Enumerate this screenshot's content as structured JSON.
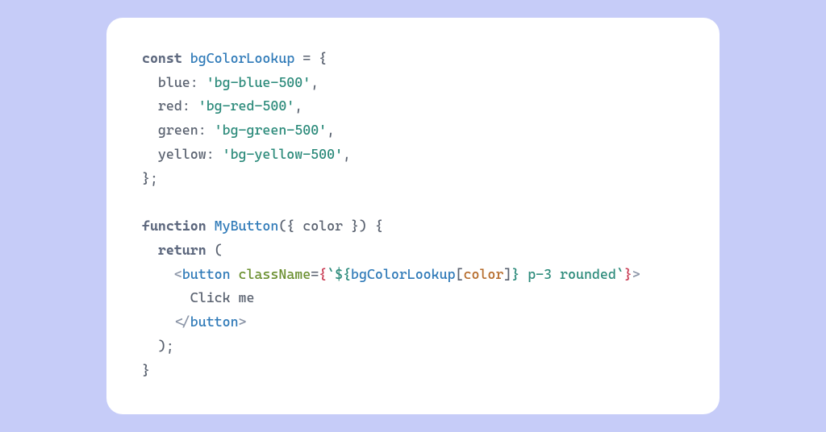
{
  "code": {
    "l1": {
      "kw": "const",
      "sp": " ",
      "id": "bgColorLookup",
      "rest": " = {"
    },
    "l2": {
      "indent": "  ",
      "key": "blue",
      "colon": ": ",
      "val": "'bg-blue-500'",
      "comma": ","
    },
    "l3": {
      "indent": "  ",
      "key": "red",
      "colon": ": ",
      "val": "'bg-red-500'",
      "comma": ","
    },
    "l4": {
      "indent": "  ",
      "key": "green",
      "colon": ": ",
      "val": "'bg-green-500'",
      "comma": ","
    },
    "l5": {
      "indent": "  ",
      "key": "yellow",
      "colon": ": ",
      "val": "'bg-yellow-500'",
      "comma": ","
    },
    "l6": {
      "text": "};"
    },
    "l7": {
      "text": ""
    },
    "l8": {
      "kw": "function",
      "sp": " ",
      "fn": "MyButton",
      "open": "({ ",
      "arg": "color",
      "close": " }) {"
    },
    "l9": {
      "indent": "  ",
      "kw": "return",
      "rest": " ("
    },
    "l10": {
      "indent": "    ",
      "lt": "<",
      "tag": "button",
      "sp": " ",
      "attr": "className",
      "eq": "=",
      "jo": "{",
      "bt1": "`",
      "ds": "${",
      "lookup": "bgColorLookup",
      "lb": "[",
      "var": "color",
      "rb": "]",
      "de": "}",
      "tail": " p-3 rounded",
      "bt2": "`",
      "jc": "}",
      "gt": ">"
    },
    "l11": {
      "indent": "      ",
      "text": "Click me"
    },
    "l12": {
      "indent": "    ",
      "lt": "</",
      "tag": "button",
      "gt": ">"
    },
    "l13": {
      "indent": "  ",
      "text": ");"
    },
    "l14": {
      "text": "}"
    }
  }
}
